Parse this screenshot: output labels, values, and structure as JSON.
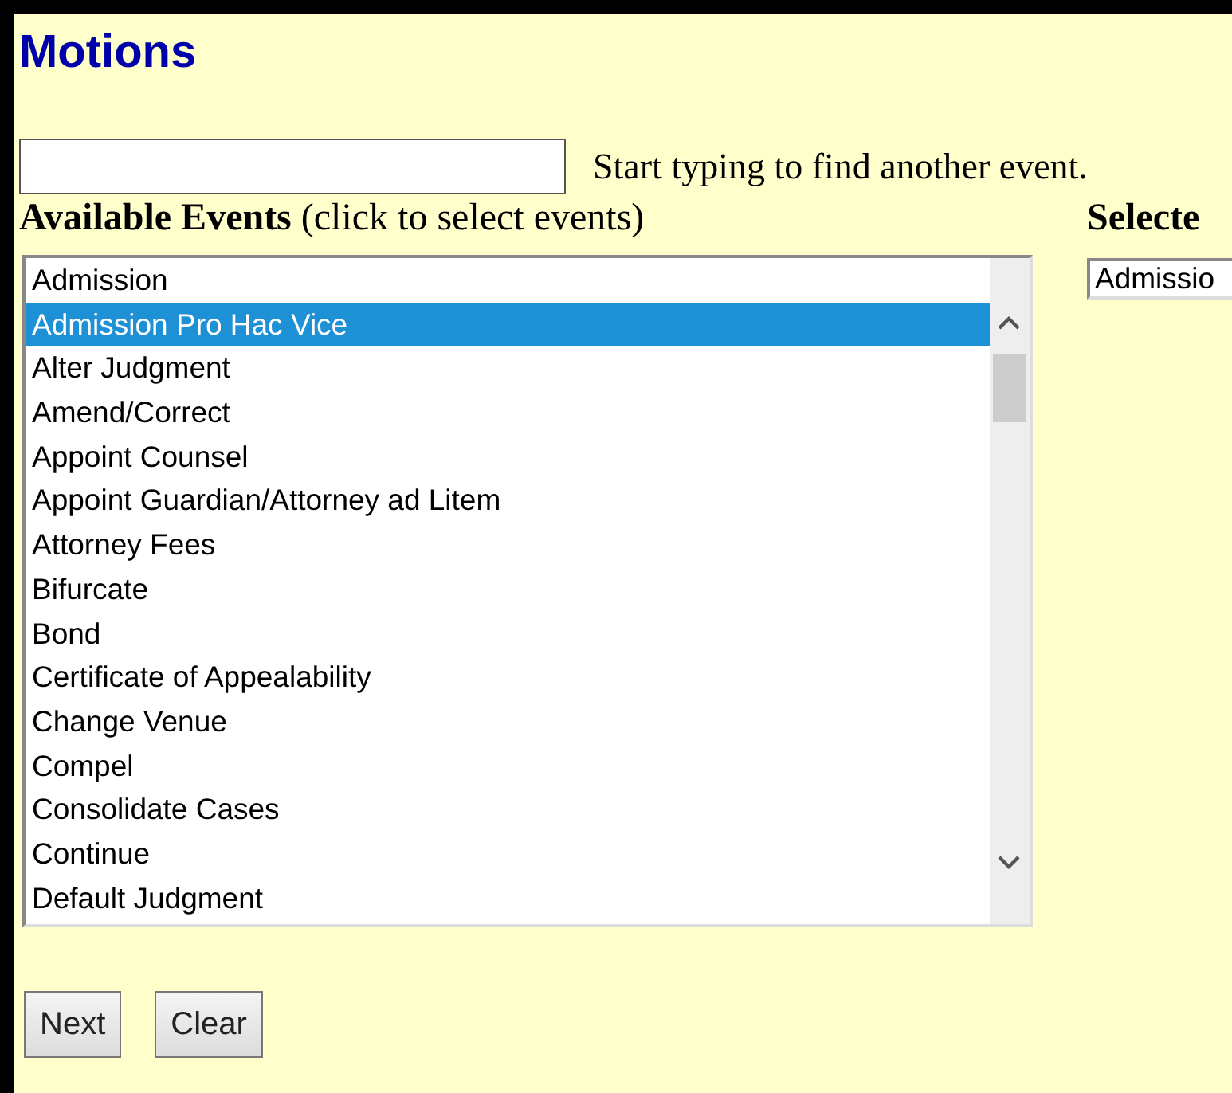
{
  "title": "Motions",
  "search": {
    "hint": "Start typing to find another event."
  },
  "available": {
    "heading": "Available Events",
    "note": "(click to select events)",
    "items": [
      {
        "label": "Admission",
        "selected": false
      },
      {
        "label": "Admission Pro Hac Vice",
        "selected": true
      },
      {
        "label": "Alter Judgment",
        "selected": false
      },
      {
        "label": "Amend/Correct",
        "selected": false
      },
      {
        "label": "Appoint Counsel",
        "selected": false
      },
      {
        "label": "Appoint Guardian/Attorney ad Litem",
        "selected": false
      },
      {
        "label": "Attorney Fees",
        "selected": false
      },
      {
        "label": "Bifurcate",
        "selected": false
      },
      {
        "label": "Bond",
        "selected": false
      },
      {
        "label": "Certificate of Appealability",
        "selected": false
      },
      {
        "label": "Change Venue",
        "selected": false
      },
      {
        "label": "Compel",
        "selected": false
      },
      {
        "label": "Consolidate Cases",
        "selected": false
      },
      {
        "label": "Continue",
        "selected": false
      },
      {
        "label": "Default Judgment",
        "selected": false
      }
    ]
  },
  "selected_events": {
    "heading": "Selecte",
    "items": [
      "Admissio"
    ]
  },
  "buttons": [
    "Next",
    "Clear"
  ]
}
